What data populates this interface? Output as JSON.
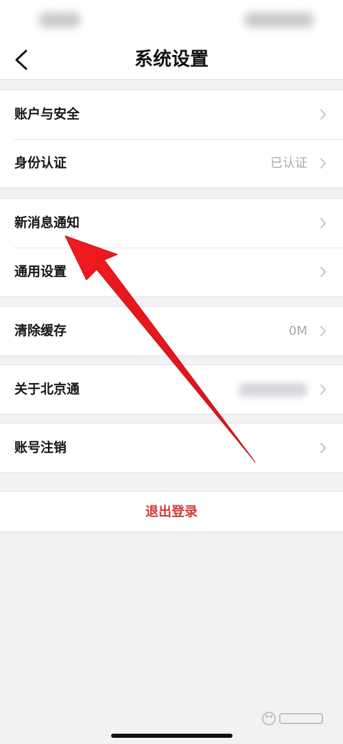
{
  "header": {
    "title": "系统设置",
    "back_icon": "chevron-left-icon"
  },
  "groups": [
    {
      "items": [
        {
          "label": "账户与安全",
          "value": ""
        },
        {
          "label": "身份认证",
          "value": "已认证"
        }
      ]
    },
    {
      "items": [
        {
          "label": "新消息通知",
          "value": ""
        },
        {
          "label": "通用设置",
          "value": ""
        }
      ]
    },
    {
      "items": [
        {
          "label": "清除缓存",
          "value": "0M"
        }
      ]
    },
    {
      "items": [
        {
          "label": "关于北京通",
          "value": ""
        }
      ]
    },
    {
      "items": [
        {
          "label": "账号注销",
          "value": ""
        }
      ]
    }
  ],
  "logout": {
    "label": "退出登录"
  },
  "colors": {
    "accent_red": "#d03a34",
    "annotation_arrow": "#e8141a",
    "background": "#f2f2f4"
  },
  "icons": {
    "row_chevron": "chevron-right-icon"
  }
}
